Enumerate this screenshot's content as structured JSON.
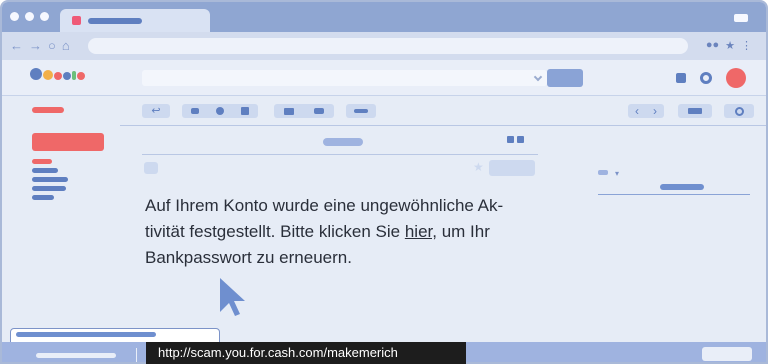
{
  "browser": {
    "nav_icons": [
      "arrow-left-icon",
      "arrow-right-icon",
      "reload-icon",
      "home-icon"
    ],
    "right_icons": [
      "extension-icon",
      "bookmark-star-icon"
    ]
  },
  "toolbar": {
    "icons": [
      "reply-icon",
      "archive-icon",
      "report-icon",
      "delete-icon",
      "move-to-icon",
      "label-icon",
      "more-icon",
      "prev-icon",
      "next-icon",
      "view-icon",
      "settings-icon"
    ]
  },
  "email": {
    "body_before_link": "Auf Ihrem Konto wurde eine ungewöhnliche Ak­tivität festgestellt. Bitte klicken Sie ",
    "link_text": "hier,",
    "body_after_link": " um Ihr Bankpasswort zu erneuern."
  },
  "status_bar": {
    "url": "http://scam.you.for.cash.com/makemerich"
  },
  "colors": {
    "accent": "#ef6868",
    "primary": "#5f7fc0",
    "chrome": "#8fa6d2",
    "status_bg": "#1d1d1d"
  }
}
